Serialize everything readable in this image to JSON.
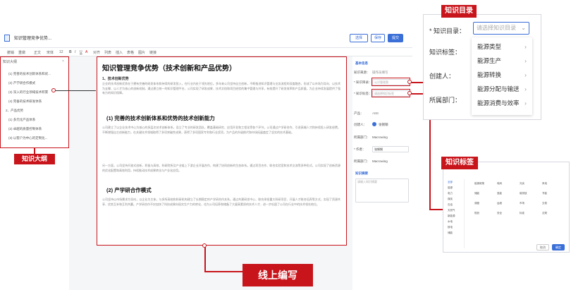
{
  "app": {
    "doc_title": "知识管理竞争优势..."
  },
  "header": {
    "btn_select": "选择",
    "btn_save": "保存",
    "btn_submit": "提交"
  },
  "toolbar": {
    "items": [
      "撤销",
      "重做",
      "正文",
      "宋体",
      "12",
      "B",
      "I",
      "U",
      "A",
      "对齐",
      "列表",
      "插入",
      "表格",
      "图片",
      "链接"
    ]
  },
  "outline": {
    "title": "知识大纲",
    "items": [
      "(1) 完善的技术创新体系和优...",
      "(2) 产学研合作模式",
      "(3) 深入的行业领域技术积累",
      "(4) 完备的技术研发体系",
      "2、产品优势",
      "(1) 多元化产品体系",
      "(2) 卓越的质量控制体系",
      "(3) 以客户为中心的定制化..."
    ]
  },
  "document": {
    "h_main": "知识管理竞争优势（技术创新和产品优势）",
    "h_sub": "1、技术创新优势",
    "p1": "企业的技术创新优势在于拥有完善的研发体系和持续的研发投入，在行业内处于领先地位。多年来公司坚持自主创新，不断推进知识管理与业务流程的深度融合，形成了以市场为导向、以技术为支撑、以人才为核心的创新机制。通过建立统一的知识管理平台，公司实现了研发成果、技术文档和项目经验的集中管理与共享，有效提升了研发效率和产品质量，为企业持续发展提供了强有力的知识保障。",
    "h_sec1": "(1) 完善的技术创新体系和优势的技术创新能力",
    "p2": "公司建立了以企业技术中心为核心的多层次技术创新体系，设立了专业的研发团队，覆盖基础研究、应用开发和工程化等各个环节。公司通过产学研合作、引进高端人才和持续投入研发经费，不断增强自主创新能力，在关键技术领域取得了多项突破性成果，获得了多项国家专利和行业奖项，为产品的升级换代和市场拓展奠定了坚实的技术基础。",
    "p3": "另一方面，公司坚持开放式创新，积极与高校、科研院所及产业链上下游企业开展合作，构建了协同创新的生态体系。通过项目合作、联合实验室和技术交流等多种形式，公司实现了创新资源的优化配置和高效利用，持续推动技术成果转化与产业化应用。",
    "h_sec2": "(2) 产学研合作模式",
    "p4": "公司坚持以市场需求为导向，以企业为主体，与多所高校和科研机构建立了长期稳定的产学研合作关系。通过共建研发中心、联合承担重大科研项目、开展人才联合培养等方式，实现了资源共享、优势互补和互利共赢。产学研合作不仅加快了科技成果向现实生产力的转化，也为公司培养和储备了大量高素质的技术人才，进一步巩固了公司在行业中的技术领先地位。"
  },
  "form": {
    "section_basic": "基本信息",
    "label_source": "知识来源：",
    "value_source": "操作员填写",
    "label_catalog": "* 知识目录：",
    "value_catalog": "认识管理营",
    "label_tags": "* 知识标签：",
    "placeholder_tags": "请选择知识标签",
    "label_product": "产品：",
    "value_product": "ABB",
    "label_creator": "创建人：",
    "value_creator": "张钢钢",
    "label_dept": "所属部门：",
    "value_dept": "Macrowing",
    "label_owner": "* 作者：",
    "value_owner": "张钢钢",
    "label_dept2": "所属部门：",
    "value_dept2": "Macrowing",
    "section_summary": "知识摘要",
    "placeholder_summary": "请输入知识摘要"
  },
  "callouts": {
    "outline": "知识大纲",
    "catalog": "知识目录",
    "tags": "知识标签",
    "editing": "线上编写"
  },
  "zoom_catalog": {
    "label_catalog": "* 知识目录：",
    "placeholder": "请选择知识目录",
    "label_tags": "知识标签：",
    "label_creator": "创建人：",
    "label_dept": "所属部门：",
    "menu": [
      "能源类型",
      "能源生产",
      "能源转换",
      "能源分配与输送",
      "能源消费与效率"
    ]
  },
  "zoom_tags": {
    "title": "知识标签",
    "left_items": [
      "全部",
      "能源",
      "电力",
      "煤炭",
      "石油",
      "天然气",
      "新能源",
      "水电",
      "核电",
      "储能"
    ],
    "grid": [
      "能源政策",
      "电网",
      "光伏",
      "风电",
      "储能",
      "氢能",
      "碳排放",
      "节能",
      "调度",
      "运维",
      "市场",
      "交易",
      "规划",
      "安全",
      "标准",
      "法规"
    ],
    "btn_cancel": "取消",
    "btn_ok": "确定"
  },
  "colors": {
    "accent": "#3a6fd8",
    "callout": "#c8141b"
  }
}
